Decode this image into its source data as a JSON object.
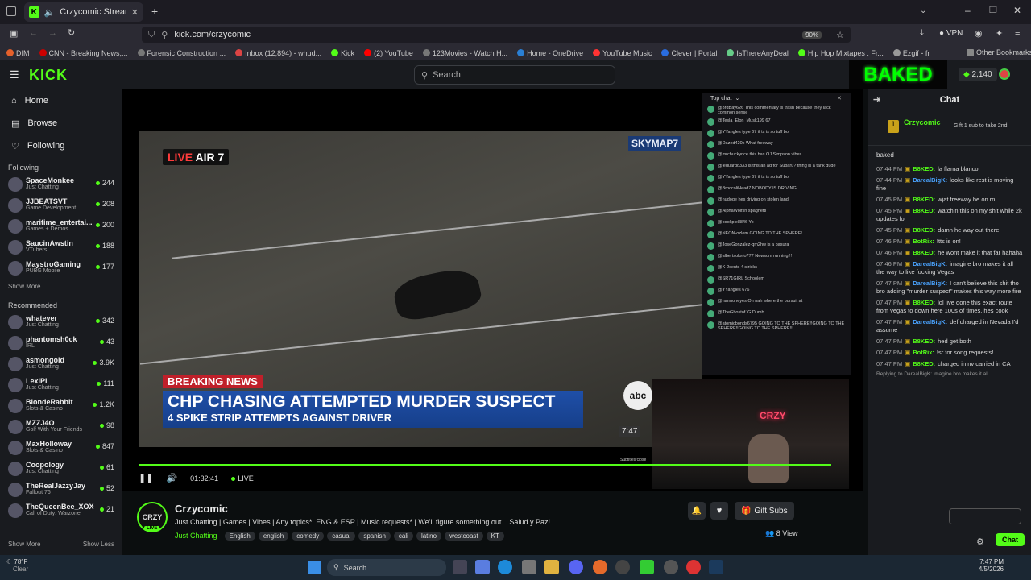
{
  "browser": {
    "tab_title": "Crzycomic Stream - Watch",
    "url": "kick.com/crzycomic",
    "zoom": "90%",
    "vpn": "VPN",
    "bookmarks": [
      "DIM",
      "CNN - Breaking News,...",
      "Forensic Construction ...",
      "Inbox (12,894) - whud...",
      "Kick",
      "(2) YouTube",
      "123Movies - Watch H...",
      "Home - OneDrive",
      "YouTube Music",
      "Clever | Portal",
      "IsThereAnyDeal",
      "Hip Hop Mixtapes : Fr...",
      "Ezgif - fr"
    ],
    "other_bookmarks": "Other Bookmarks"
  },
  "kick": {
    "logo": "KICK",
    "search_placeholder": "Search",
    "kicks": "2,140",
    "overlay_banner": "BAKED"
  },
  "sidebar": {
    "nav": [
      "Home",
      "Browse",
      "Following"
    ],
    "following_title": "Following",
    "following": [
      {
        "name": "SpaceMonkee",
        "cat": "Just Chatting",
        "viewers": "244"
      },
      {
        "name": "JJBEATSVT",
        "cat": "Game Development",
        "viewers": "208"
      },
      {
        "name": "maritime_entertai...",
        "cat": "Games + Demos",
        "viewers": "200"
      },
      {
        "name": "SaucinAwstin",
        "cat": "VTubers",
        "viewers": "188"
      },
      {
        "name": "MaystroGaming",
        "cat": "PUBG Mobile",
        "viewers": "177"
      }
    ],
    "show_more": "Show More",
    "recommended_title": "Recommended",
    "recommended": [
      {
        "name": "whatever",
        "cat": "Just Chatting",
        "viewers": "342"
      },
      {
        "name": "phantomsh0ck",
        "cat": "IRL",
        "viewers": "43"
      },
      {
        "name": "asmongold",
        "cat": "Just Chatting",
        "viewers": "3.9K"
      },
      {
        "name": "LexiPi",
        "cat": "Just Chatting",
        "viewers": "111"
      },
      {
        "name": "BlondeRabbit",
        "cat": "Slots & Casino",
        "viewers": "1.2K"
      },
      {
        "name": "MZZJ4O",
        "cat": "Golf With Your Friends",
        "viewers": "98"
      },
      {
        "name": "MaxHolloway",
        "cat": "Slots & Casino",
        "viewers": "847"
      },
      {
        "name": "Coopology",
        "cat": "Just Chatting",
        "viewers": "61"
      },
      {
        "name": "TheRealJazzyJay",
        "cat": "Fallout 76",
        "viewers": "52"
      },
      {
        "name": "TheQueenBee_XOXO",
        "cat": "Call of Duty: Warzone",
        "viewers": "21"
      }
    ],
    "show_more2": "Show More",
    "show_less": "Show Less"
  },
  "video": {
    "live_bug": "LIVE",
    "air": "AIR 7",
    "skymap": "SKYMAP7",
    "breaking": "BREAKING NEWS",
    "headline": "CHP CHASING ATTEMPTED MURDER SUSPECT",
    "subheadline": "4 SPIKE STRIP ATTEMPTS AGAINST DRIVER",
    "abc": "abc",
    "clock": "7:47",
    "cam_sign": "CRZY",
    "subtitles": "Subtitles/close",
    "overlay_chat_title": "Top chat",
    "overlay_chat": [
      "@3rdBay626 This commentary is trash because they lack common sense",
      "@Tesla_Elon_Musk199 67",
      "@YYangles type 67 if ts is so tuff boi",
      "@Dazed420x What freeway",
      "@mrchuckyrice this has OJ Simpson vibes",
      "@leduardo333 is this an ad for Subaru? thing is a tank dude",
      "@YYangles type 67 if ts is so tuff boi",
      "@BroccoliHead7 NOBODY IS DRIVING",
      "@nudoge hes driving on stolen land",
      "@AlphaWolfsn spaghetti",
      "@bookpie8846 Yo",
      "@NEON-ozlem GOING TO THE SPHERE!",
      "@JoseGonzalez-qm2hw is a basura",
      "@albertsolorio777 Newsom running!!!",
      "@K-2cents 4 stricks",
      "@SR71GIRL Schoolem",
      "@YYangles 676",
      "@harmoneyes Oh nah where the pursuit at",
      "@TheGhostofJG Dumb",
      "@atomicbonds6795 GOING TO THE SPHERE!!GOING TO THE SPHERE!!GOING TO THE SPHERE!!"
    ]
  },
  "controls": {
    "time": "01:32:41",
    "live": "LIVE"
  },
  "channel": {
    "avatar": "CRZY",
    "live_badge": "LIVE",
    "name": "Crzycomic",
    "title": "Just Chatting | Games | Vibes | Any topics*| ENG & ESP | Music requests* | We'll figure something out... Salud y Paz!",
    "category": "Just Chatting",
    "tags": [
      "English",
      "english",
      "comedy",
      "casual",
      "spanish",
      "cali",
      "latino",
      "westcoast",
      "KT"
    ],
    "gift_subs": "Gift Subs",
    "viewers": "8 View"
  },
  "chat": {
    "title": "Chat",
    "pinned_user": "Crzycomic",
    "pinned_text": "Gift 1 sub to take 2nd",
    "first_line": "baked",
    "messages": [
      {
        "time": "07:44 PM",
        "user": "B8KED:",
        "color": "#53fc18",
        "text": "la flama blanco"
      },
      {
        "time": "07:44 PM",
        "user": "DarealBigK:",
        "color": "#4aa3ff",
        "text": "looks like rest is moving fine"
      },
      {
        "time": "07:45 PM",
        "user": "B8KED:",
        "color": "#53fc18",
        "text": "wjat freeway he on rn"
      },
      {
        "time": "07:45 PM",
        "user": "B8KED:",
        "color": "#53fc18",
        "text": "watchin this on my shit while 2k updates lol"
      },
      {
        "time": "07:45 PM",
        "user": "B8KED:",
        "color": "#53fc18",
        "text": "damn he way out there"
      },
      {
        "time": "07:46 PM",
        "user": "BotRix:",
        "color": "#53fc18",
        "text": "!tts is on!"
      },
      {
        "time": "07:46 PM",
        "user": "B8KED:",
        "color": "#53fc18",
        "text": "he wont make it that far hahaha"
      },
      {
        "time": "07:46 PM",
        "user": "DarealBigK:",
        "color": "#4aa3ff",
        "text": "imagine bro makes it all the way to like fucking Vegas"
      },
      {
        "time": "07:47 PM",
        "user": "DarealBigK:",
        "color": "#4aa3ff",
        "text": "I can't believe this shit tho bro adding \"murder suspect\" makes this way more fire"
      },
      {
        "time": "07:47 PM",
        "user": "B8KED:",
        "color": "#53fc18",
        "text": "lol live done this exact route from vegas to down here 100s of times, hes cook"
      },
      {
        "time": "07:47 PM",
        "user": "DarealBigK:",
        "color": "#4aa3ff",
        "text": "def charged in Nevada I'd assume"
      },
      {
        "time": "07:47 PM",
        "user": "B8KED:",
        "color": "#53fc18",
        "text": "hed get both"
      },
      {
        "time": "07:47 PM",
        "user": "BotRix:",
        "color": "#53fc18",
        "text": "!sr for song requests!"
      },
      {
        "time": "07:47 PM",
        "user": "B8KED:",
        "color": "#53fc18",
        "text": "charged in nv carried in CA"
      }
    ],
    "reply_line": "Replying to DarealBigK: imagine bro makes it all...",
    "chat_button": "Chat"
  },
  "taskbar": {
    "weather_temp": "78°F",
    "weather_desc": "Clear",
    "search": "Search",
    "time": "7:47 PM",
    "date": "4/5/2026"
  }
}
